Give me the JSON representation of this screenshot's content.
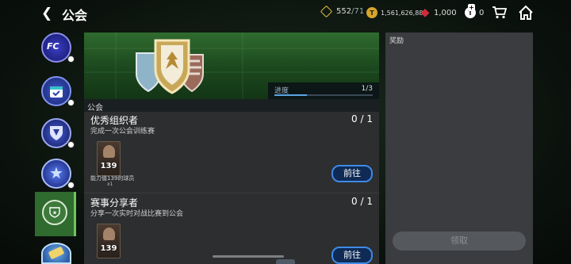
{
  "header": {
    "back_icon": "chevron-left-icon",
    "title": "公会"
  },
  "currencies": [
    {
      "name": "gold-diamond-icon",
      "value": "552",
      "secondary": "/71",
      "color": "#e4c23d"
    },
    {
      "name": "coin-icon",
      "value": "1,561,626,887",
      "color": "#d7a52a"
    },
    {
      "name": "gem-icon",
      "value": "1,000",
      "color": "#d12b3b"
    },
    {
      "name": "token-icon",
      "value": "0",
      "color": "#ffffff"
    }
  ],
  "nav": {
    "items": [
      "fc-logo-icon",
      "calendar-check-icon",
      "trophy-shield-icon",
      "star-badge-icon",
      "club-star-icon",
      "ticket-icon"
    ],
    "active_index": 4,
    "accent": "#6fc45b"
  },
  "banner": {
    "progress_label": "进度",
    "progress_value": "1/3",
    "progress_fraction": 0.333
  },
  "section_label": "公会",
  "tasks": [
    {
      "name": "优秀组织者",
      "description": "完成一次公会训练赛",
      "count": "0 / 1",
      "card_rating": "139",
      "card_caption": "能力值139的球员",
      "card_qty": "x1",
      "button": "前往"
    },
    {
      "name": "赛事分享者",
      "description": "分享一次实时对战比赛到公会",
      "count": "0 / 1",
      "card_rating": "139",
      "card_caption": "",
      "card_qty": "",
      "button": "前往"
    }
  ],
  "reward_panel": {
    "title": "奖励",
    "claim_button": "领取"
  }
}
